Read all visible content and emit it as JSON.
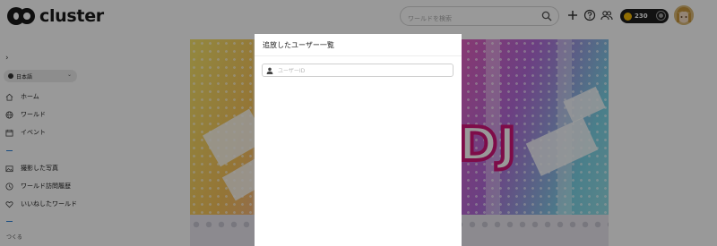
{
  "header": {
    "logo_text": "cluster",
    "search_placeholder": "ワールドを検索",
    "coins": "230"
  },
  "sidebar": {
    "language": "日本語",
    "items": [
      {
        "label": "ホーム",
        "icon": "home-icon"
      },
      {
        "label": "ワールド",
        "icon": "globe-icon"
      },
      {
        "label": "イベント",
        "icon": "calendar-icon"
      },
      {
        "label": "撮影した写真",
        "icon": "photo-icon"
      },
      {
        "label": "ワールド訪問履歴",
        "icon": "history-icon"
      },
      {
        "label": "いいねしたワールド",
        "icon": "heart-icon"
      }
    ],
    "create_label": "つくる"
  },
  "banner": {
    "text": "DJ"
  },
  "modal": {
    "title": "追放したユーザー一覧",
    "user_id_placeholder": "ユーザーID"
  },
  "colors": {
    "accent": "#2a7fd8",
    "coin_gold": "#f2b705",
    "dj_pink": "#d3157a"
  }
}
